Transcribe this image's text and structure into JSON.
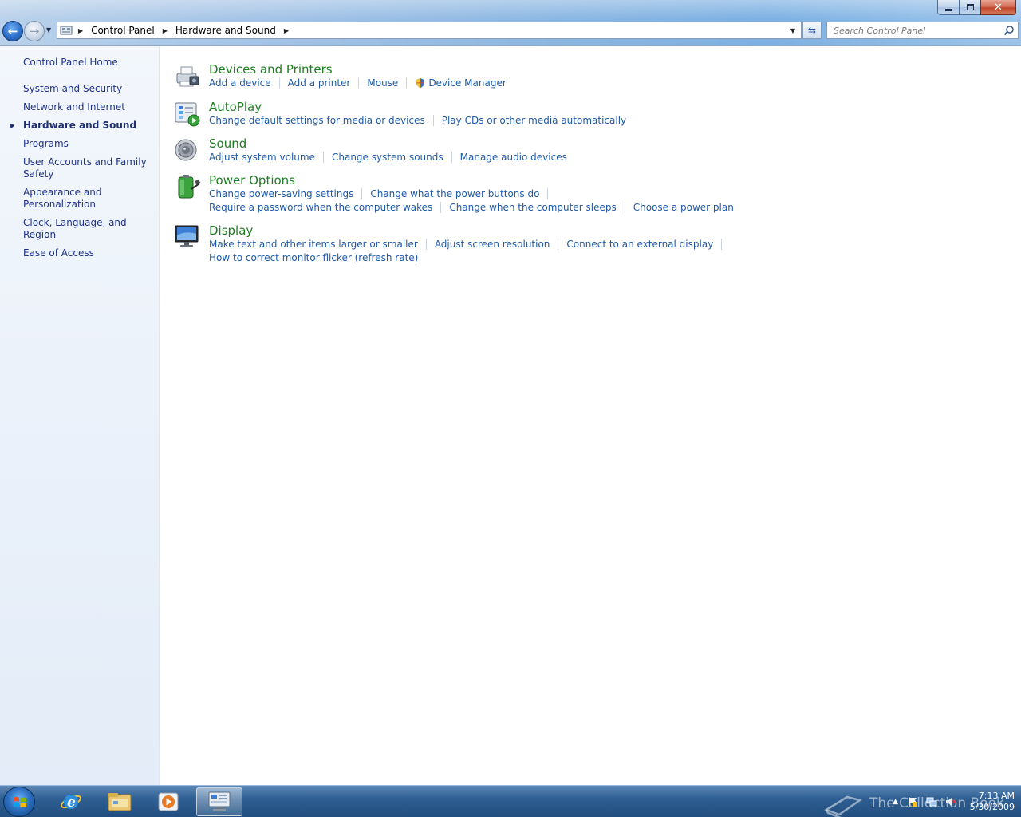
{
  "window": {
    "controls": {
      "minimize": "minimize",
      "maximize": "restore",
      "close": "close"
    }
  },
  "nav": {
    "breadcrumbs": [
      "Control Panel",
      "Hardware and Sound"
    ],
    "search_placeholder": "Search Control Panel"
  },
  "sidebar": {
    "home": "Control Panel Home",
    "items": [
      {
        "label": "System and Security",
        "active": false
      },
      {
        "label": "Network and Internet",
        "active": false
      },
      {
        "label": "Hardware and Sound",
        "active": true
      },
      {
        "label": "Programs",
        "active": false
      },
      {
        "label": "User Accounts and Family Safety",
        "active": false
      },
      {
        "label": "Appearance and Personalization",
        "active": false
      },
      {
        "label": "Clock, Language, and Region",
        "active": false
      },
      {
        "label": "Ease of Access",
        "active": false
      }
    ]
  },
  "categories": [
    {
      "title": "Devices and Printers",
      "icon": "printer-icon",
      "rows": [
        [
          "Add a device",
          "Add a printer",
          "Mouse",
          "Device Manager"
        ]
      ]
    },
    {
      "title": "AutoPlay",
      "icon": "autoplay-icon",
      "rows": [
        [
          "Change default settings for media or devices",
          "Play CDs or other media automatically"
        ]
      ]
    },
    {
      "title": "Sound",
      "icon": "speaker-icon",
      "rows": [
        [
          "Adjust system volume",
          "Change system sounds",
          "Manage audio devices"
        ]
      ]
    },
    {
      "title": "Power Options",
      "icon": "battery-icon",
      "rows": [
        [
          "Change power-saving settings",
          "Change what the power buttons do"
        ],
        [
          "Require a password when the computer wakes",
          "Change when the computer sleeps",
          "Choose a power plan"
        ]
      ]
    },
    {
      "title": "Display",
      "icon": "monitor-icon",
      "rows": [
        [
          "Make text and other items larger or smaller",
          "Adjust screen resolution",
          "Connect to an external display"
        ],
        [
          "How to correct monitor flicker (refresh rate)"
        ]
      ]
    }
  ],
  "taskbar": {
    "pinned": [
      "internet-explorer-icon",
      "windows-explorer-icon",
      "media-player-icon",
      "control-panel-icon"
    ],
    "watermark": "The Collection Book",
    "time": "7:13 AM",
    "date": "5/30/2009"
  },
  "colors": {
    "link": "#1e5aa8",
    "category_title": "#1e7d21",
    "nav_text": "#1e3287"
  }
}
